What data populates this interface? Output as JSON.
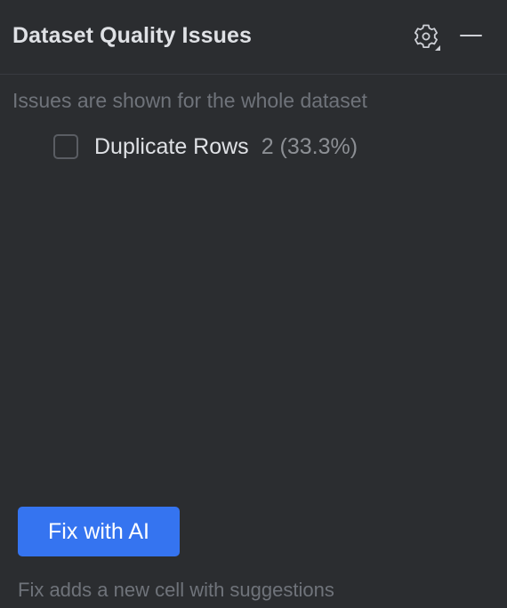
{
  "header": {
    "title": "Dataset Quality Issues",
    "settings_icon": "gear-with-dropdown-icon",
    "minimize_icon": "minimize-icon"
  },
  "info": {
    "text": "Issues are shown for the whole dataset"
  },
  "issues": [
    {
      "label": "Duplicate Rows",
      "count": "2 (33.3%)",
      "checked": false
    }
  ],
  "actions": {
    "fix_label": "Fix with AI",
    "fix_color": "#3574f0",
    "footer_note": "Fix adds a new cell with suggestions"
  },
  "colors": {
    "background": "#2b2d30",
    "text_primary": "#dfe1e5",
    "text_muted": "#6f737a",
    "accent": "#3574f0"
  }
}
